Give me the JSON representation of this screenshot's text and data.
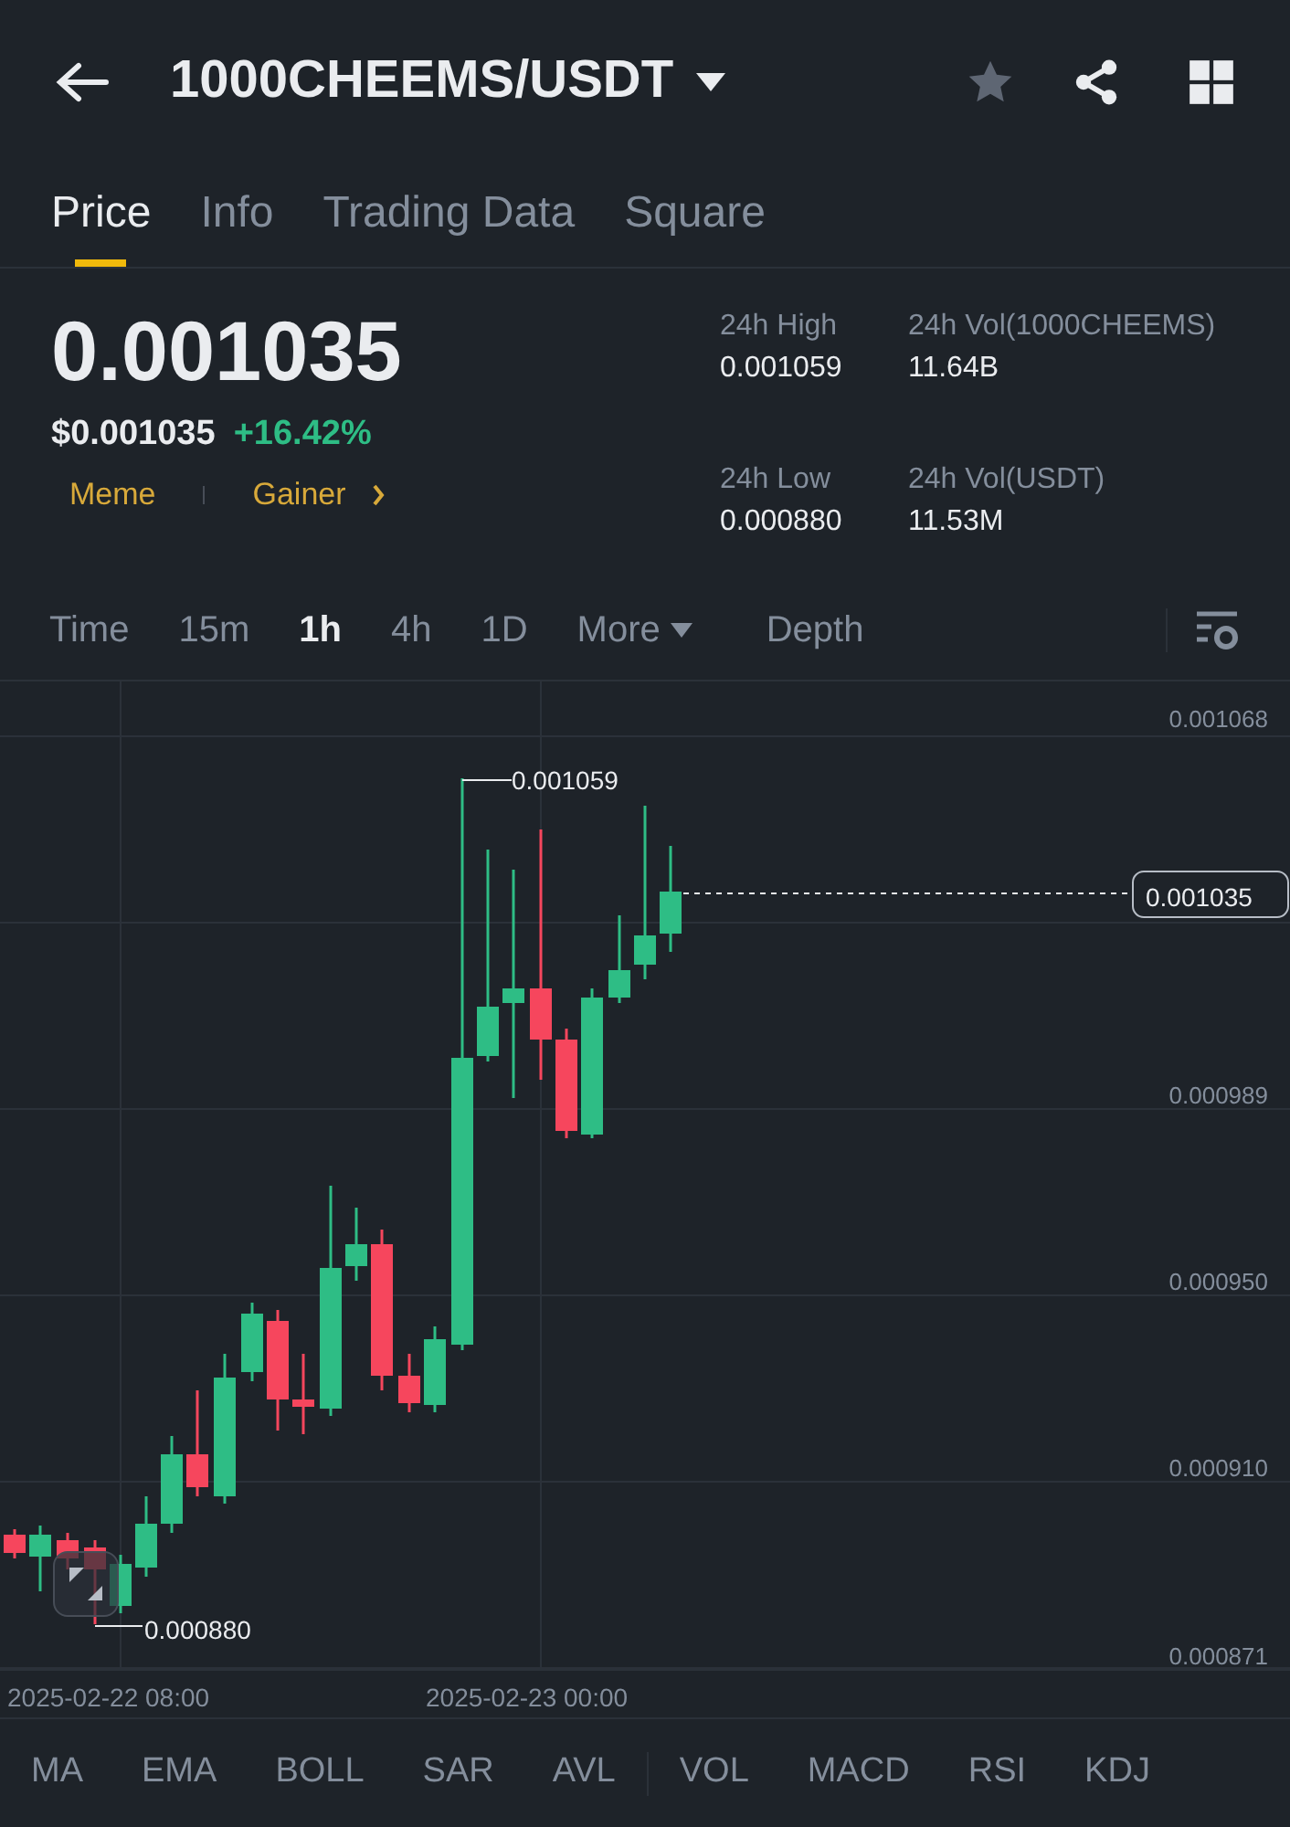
{
  "header": {
    "pair": "1000CHEEMS/USDT",
    "favorite": false
  },
  "tabs": [
    {
      "label": "Price",
      "selected": true
    },
    {
      "label": "Info",
      "selected": false
    },
    {
      "label": "Trading Data",
      "selected": false
    },
    {
      "label": "Square",
      "selected": false
    }
  ],
  "price": {
    "last": "0.001035",
    "usd": "$0.001035",
    "change": "+16.42%",
    "tags": [
      "Meme",
      "Gainer"
    ]
  },
  "stats": [
    {
      "label": "24h High",
      "value": "0.001059"
    },
    {
      "label": "24h Vol(1000CHEEMS)",
      "value": "11.64B"
    },
    {
      "label": "24h Low",
      "value": "0.000880"
    },
    {
      "label": "24h Vol(USDT)",
      "value": "11.53M"
    }
  ],
  "intervals": [
    {
      "label": "Time",
      "kind": "interval",
      "selected": false
    },
    {
      "label": "15m",
      "kind": "interval",
      "selected": false
    },
    {
      "label": "1h",
      "kind": "interval",
      "selected": true
    },
    {
      "label": "4h",
      "kind": "interval",
      "selected": false
    },
    {
      "label": "1D",
      "kind": "interval",
      "selected": false
    },
    {
      "label": "More",
      "kind": "menu",
      "selected": false
    },
    {
      "label": "Depth",
      "kind": "view",
      "selected": false
    }
  ],
  "chart": {
    "y_labels": [
      "0.001068",
      "0.000989",
      "0.000950",
      "0.000910",
      "0.000871"
    ],
    "x_labels": [
      "2025-02-22 08:00",
      "2025-02-23 00:00"
    ],
    "high_marker": "0.001059",
    "low_marker": "0.000880",
    "last_price": "0.001035"
  },
  "indicator_groups": [
    {
      "items": [
        "MA",
        "EMA",
        "BOLL",
        "SAR",
        "AVL"
      ]
    },
    {
      "items": [
        "VOL",
        "MACD",
        "RSI",
        "KDJ"
      ]
    }
  ]
}
